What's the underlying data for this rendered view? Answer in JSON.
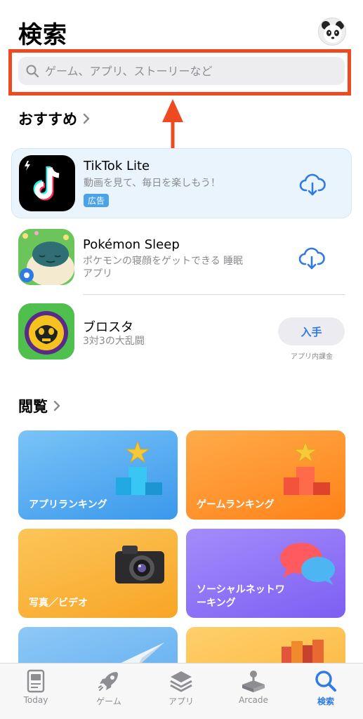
{
  "page_title": "検索",
  "search": {
    "placeholder": "ゲーム、アプリ、ストーリーなど"
  },
  "recommended": {
    "title": "おすすめ",
    "apps": [
      {
        "name": "TikTok Lite",
        "subtitle": "動画を見て、毎日を楽しもう！",
        "badge": "広告",
        "action": "download-cloud-icon"
      },
      {
        "name": "Pokémon Sleep",
        "subtitle_line1": "ポケモンの寝顔をゲットできる 睡眠",
        "subtitle_line2": "アプリ",
        "action": "download-cloud-icon"
      },
      {
        "name": "ブロスタ",
        "subtitle": "3対3の大乱闘",
        "action_label": "入手",
        "note": "アプリ内課金"
      }
    ]
  },
  "browse": {
    "title": "閲覧",
    "tiles": [
      {
        "label": "アプリランキング",
        "color": "#4aa6f0"
      },
      {
        "label": "ゲームランキング",
        "color": "#ff8c1f"
      },
      {
        "label": "写真／ビデオ",
        "color": "#fbb13c"
      },
      {
        "label_line1": "ソーシャルネットワ",
        "label_line2": "ーキング",
        "color": "#8e72f4"
      }
    ]
  },
  "tabbar": {
    "items": [
      {
        "label": "Today",
        "icon": "today-icon"
      },
      {
        "label": "ゲーム",
        "icon": "rocket-icon"
      },
      {
        "label": "アプリ",
        "icon": "layers-icon"
      },
      {
        "label": "Arcade",
        "icon": "arcade-joystick-icon"
      },
      {
        "label": "検索",
        "icon": "search-icon",
        "active": true
      }
    ]
  },
  "colors": {
    "accent": "#2f7ae5",
    "highlight": "#ee4a22"
  }
}
